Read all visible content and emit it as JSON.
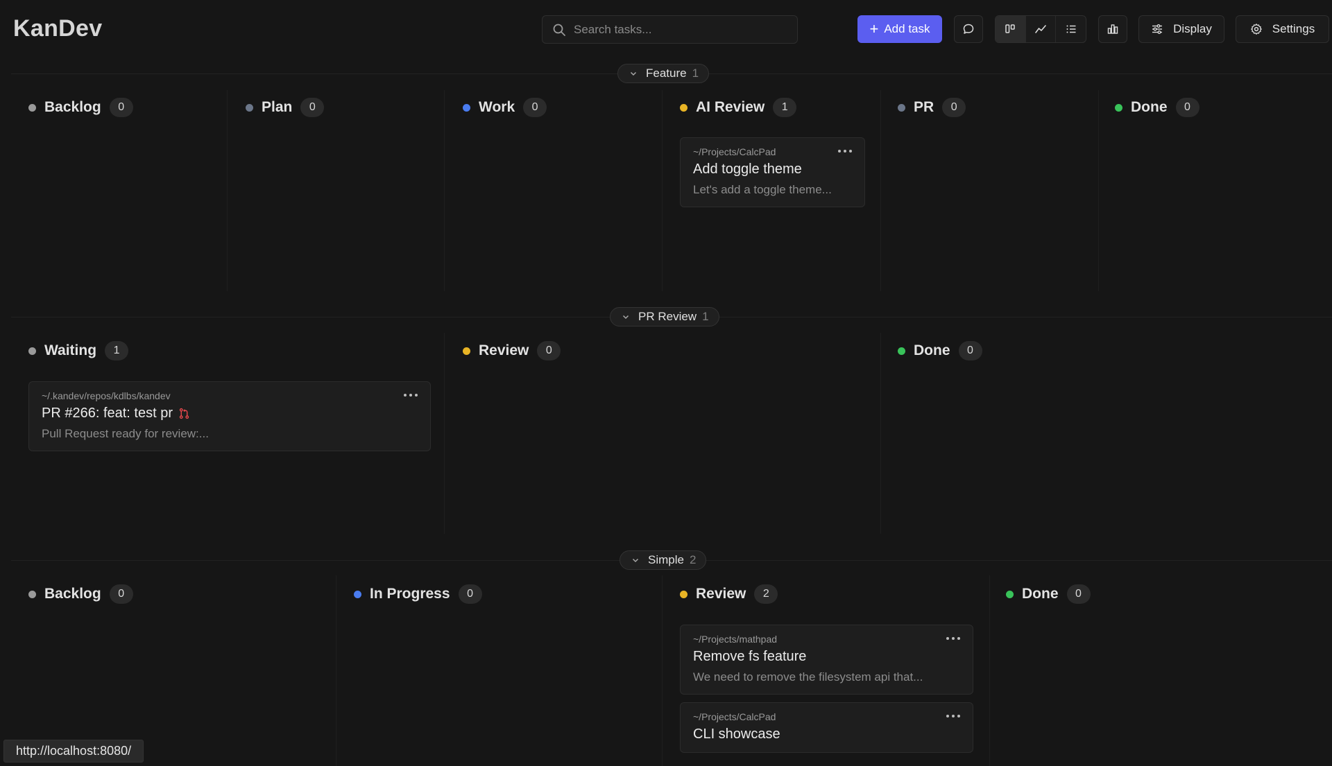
{
  "app": {
    "title": "KanDev"
  },
  "search": {
    "placeholder": "Search tasks..."
  },
  "toolbar": {
    "add_label": "Add task",
    "display_label": "Display",
    "settings_label": "Settings"
  },
  "colors": {
    "accent": "#5b5ef0",
    "gray": "#9a9a9a",
    "slate": "#6b7689",
    "blue": "#4a7cf0",
    "yellow": "#e8b425",
    "green": "#39c35a",
    "pr_red": "#e5484d"
  },
  "groups": [
    {
      "name": "Feature",
      "count": "1",
      "columns": [
        {
          "title": "Backlog",
          "count": "0"
        },
        {
          "title": "Plan",
          "count": "0"
        },
        {
          "title": "Work",
          "count": "0"
        },
        {
          "title": "AI Review",
          "count": "1",
          "cards": [
            {
              "path": "~/Projects/CalcPad",
              "title": "Add toggle theme",
              "desc": "Let's add a toggle theme..."
            }
          ]
        },
        {
          "title": "PR",
          "count": "0"
        },
        {
          "title": "Done",
          "count": "0"
        }
      ]
    },
    {
      "name": "PR Review",
      "count": "1",
      "columns": [
        {
          "title": "Waiting",
          "count": "1",
          "cards": [
            {
              "path": "~/.kandev/repos/kdlbs/kandev",
              "title": "PR #266: feat: test pr",
              "desc": "Pull Request ready for review:..."
            }
          ]
        },
        {
          "title": "Review",
          "count": "0"
        },
        {
          "title": "Done",
          "count": "0"
        }
      ]
    },
    {
      "name": "Simple",
      "count": "2",
      "columns": [
        {
          "title": "Backlog",
          "count": "0"
        },
        {
          "title": "In Progress",
          "count": "0"
        },
        {
          "title": "Review",
          "count": "2",
          "cards": [
            {
              "path": "~/Projects/mathpad",
              "title": "Remove fs feature",
              "desc": "We need to remove the filesystem api that..."
            },
            {
              "path": "~/Projects/CalcPad",
              "title": "CLI showcase"
            }
          ]
        },
        {
          "title": "Done",
          "count": "0"
        }
      ]
    }
  ],
  "status_bar": {
    "url": "http://localhost:8080/"
  }
}
